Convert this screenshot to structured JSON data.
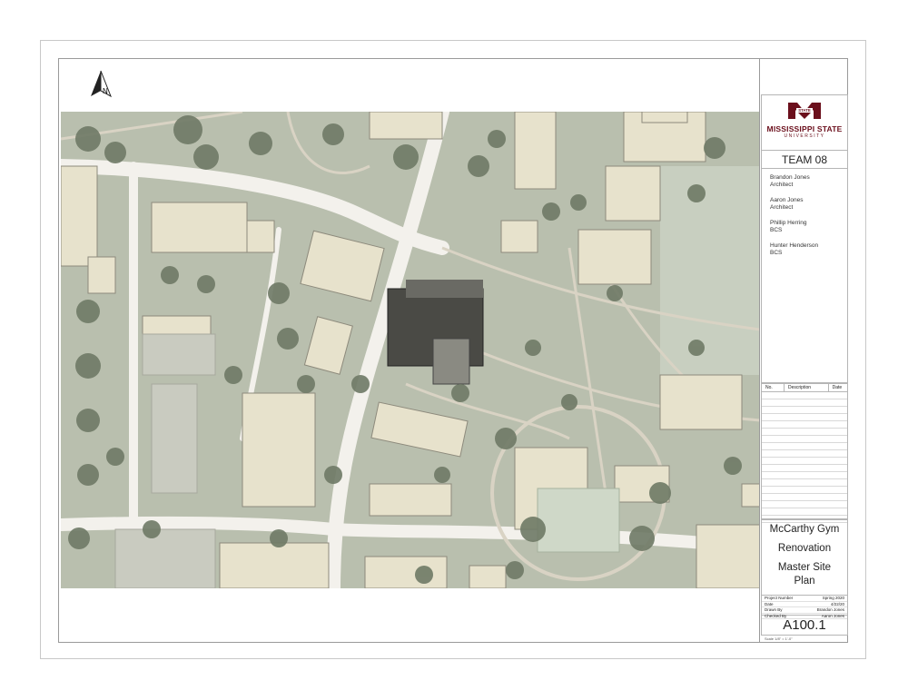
{
  "north_arrow": {
    "label": "N"
  },
  "logo": {
    "line1": "MISSISSIPPI STATE",
    "line2": "UNIVERSITY",
    "mark_text": "STATE"
  },
  "team": "TEAM 08",
  "members": [
    {
      "name": "Brandon Jones",
      "role": "Architect"
    },
    {
      "name": "Aaron Jones",
      "role": "Architect"
    },
    {
      "name": "Phillip Herring",
      "role": "BCS"
    },
    {
      "name": "Hunter Henderson",
      "role": "BCS"
    }
  ],
  "revisions": {
    "headers": [
      "No.",
      "Description",
      "Date"
    ]
  },
  "title": {
    "line1": "McCarthy Gym",
    "line2": "Renovation",
    "line3": "Master Site",
    "line4": "Plan"
  },
  "project_info": [
    {
      "label": "Project Number",
      "value": "Spring 2020"
    },
    {
      "label": "Date",
      "value": "4/22/20"
    },
    {
      "label": "Drawn By",
      "value": "Brandon Jones"
    },
    {
      "label": "Checked By",
      "value": "Aaron Jones"
    }
  ],
  "sheet_number": "A100.1",
  "scale": "Scale  1/8\" = 1'-0\"",
  "colors": {
    "ground": "#b9bfae",
    "road": "#f3f1ec",
    "building": "#e7e2cc",
    "tree": "#6f7a66",
    "gym": "#4a4a45",
    "brand": "#6b0f1c"
  }
}
